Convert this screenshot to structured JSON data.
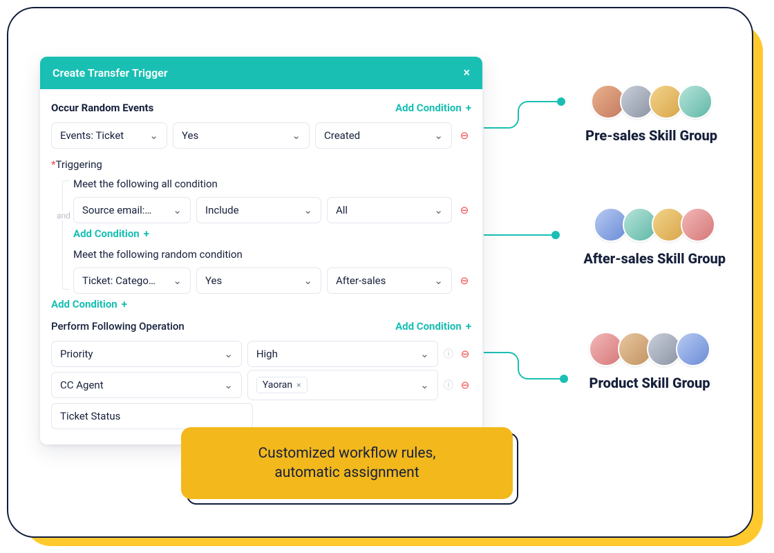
{
  "modal": {
    "title": "Create Transfer Trigger",
    "sections": {
      "occur": {
        "label": "Occur Random Events",
        "add": "Add Condition"
      },
      "triggering_label": "Triggering",
      "meet_all": "Meet the following all condition",
      "meet_random": "Meet the following random condition",
      "and": "and",
      "add_condition": "Add Condition",
      "perform": {
        "label": "Perform Following Operation",
        "add": "Add Condition"
      }
    },
    "rows": {
      "event": {
        "a": "Events: Ticket",
        "b": "Yes",
        "c": "Created"
      },
      "cond_all": {
        "a": "Source email:…",
        "b": "Include",
        "c": "All"
      },
      "cond_random": {
        "a": "Ticket: Catego…",
        "b": "Yes",
        "c": "After-sales"
      },
      "op1": {
        "a": "Priority",
        "b": "High"
      },
      "op2": {
        "a": "CC Agent",
        "b_tag": "Yaoran"
      },
      "op3": {
        "a": "Ticket Status"
      }
    }
  },
  "groups": {
    "g1": "Pre-sales Skill Group",
    "g2": "After-sales Skill Group",
    "g3": "Product Skill Group"
  },
  "callout": {
    "line1": "Customized workflow rules,",
    "line2": "automatic assignment"
  }
}
